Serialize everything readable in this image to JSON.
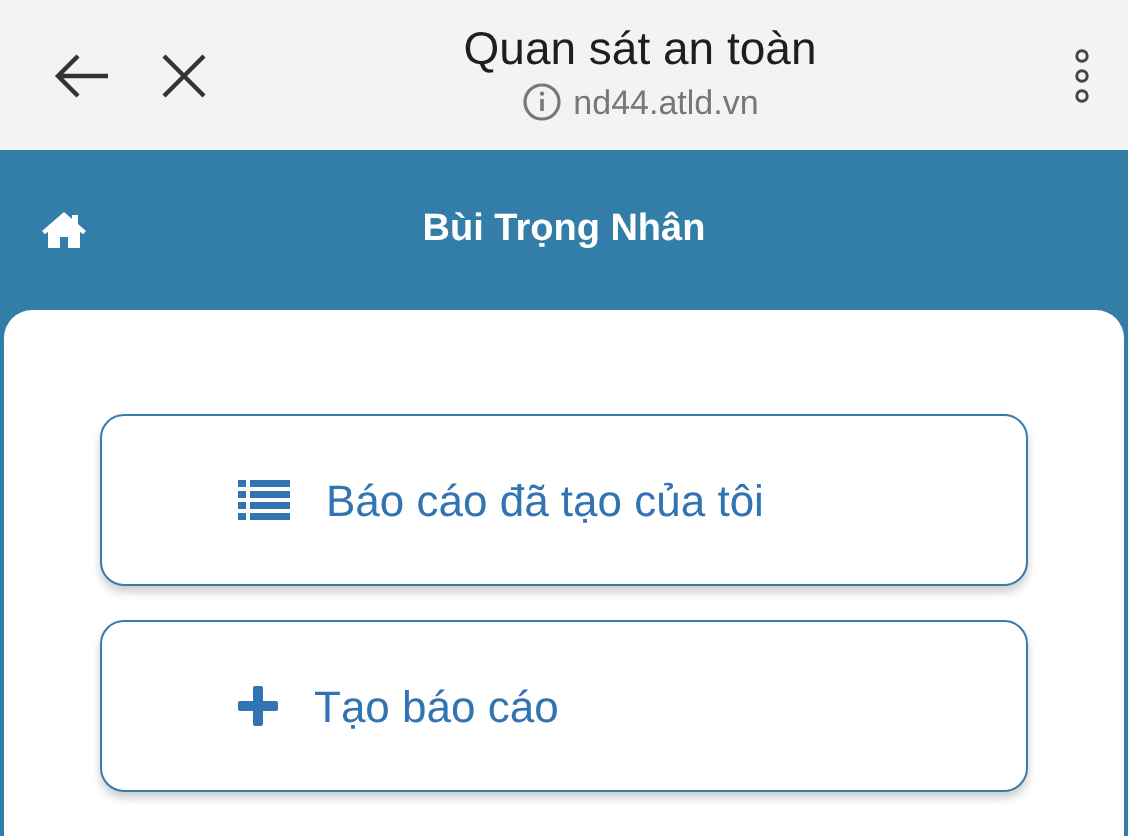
{
  "browser_bar": {
    "title": "Quan sát an toàn",
    "url": "nd44.atld.vn"
  },
  "header": {
    "title": "Bùi Trọng Nhân"
  },
  "menu_buttons": [
    {
      "label": "Báo cáo đã tạo của tôi",
      "kind": "list"
    },
    {
      "label": "Tạo báo cáo",
      "kind": "add"
    }
  ]
}
